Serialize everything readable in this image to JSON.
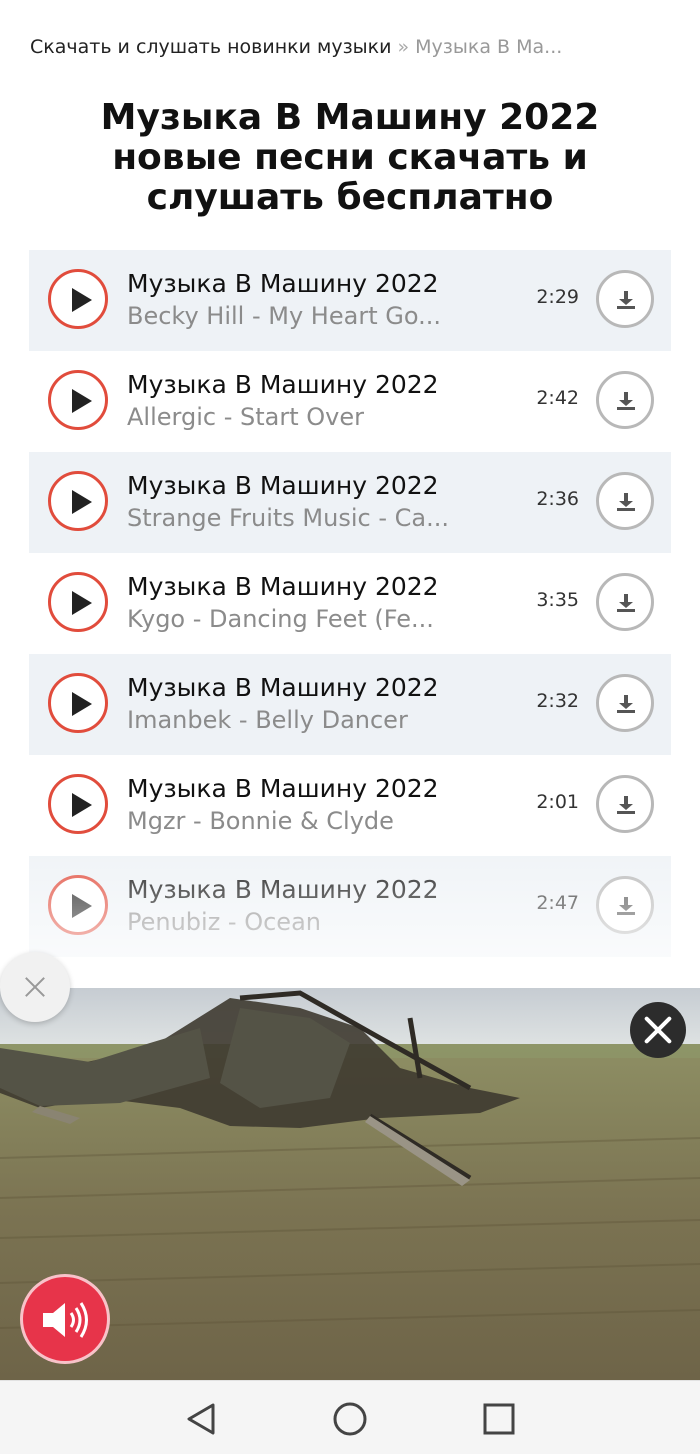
{
  "breadcrumb": {
    "home": "Скачать и слушать новинки музыки",
    "separator": "»",
    "current": "Музыка В Ма..."
  },
  "page_title": "Музыка В Машину 2022 новые песни скачать и слушать бесплатно",
  "tracks": [
    {
      "title": "Музыка В Машину 2022",
      "artist": "Becky Hill - My Heart Go...",
      "duration": "2:29"
    },
    {
      "title": "Музыка В Машину 2022",
      "artist": "Allergic - Start Over",
      "duration": "2:42"
    },
    {
      "title": "Музыка В Машину 2022",
      "artist": "Strange Fruits Music - Ca...",
      "duration": "2:36"
    },
    {
      "title": "Музыка В Машину 2022",
      "artist": "Kygo - Dancing Feet (Fe...",
      "duration": "3:35"
    },
    {
      "title": "Музыка В Машину 2022",
      "artist": "Imanbek - Belly Dancer",
      "duration": "2:32"
    },
    {
      "title": "Музыка В Машину 2022",
      "artist": "Mgzr - Bonnie & Clyde",
      "duration": "2:01"
    },
    {
      "title": "Музыка В Машину 2022",
      "artist": "Penubiz - Ocean",
      "duration": "2:47"
    }
  ],
  "ad": {
    "video": "helicopter-wreck-in-field"
  },
  "icons": {
    "play": "play-icon",
    "download": "download-icon",
    "close": "close-icon",
    "sound": "speaker-icon",
    "nav_back": "nav-back-icon",
    "nav_home": "nav-home-icon",
    "nav_recents": "nav-recents-icon"
  },
  "colors": {
    "accent_red": "#e14c3c",
    "row_shade": "#eef2f6",
    "sound_button": "#e7344a"
  }
}
